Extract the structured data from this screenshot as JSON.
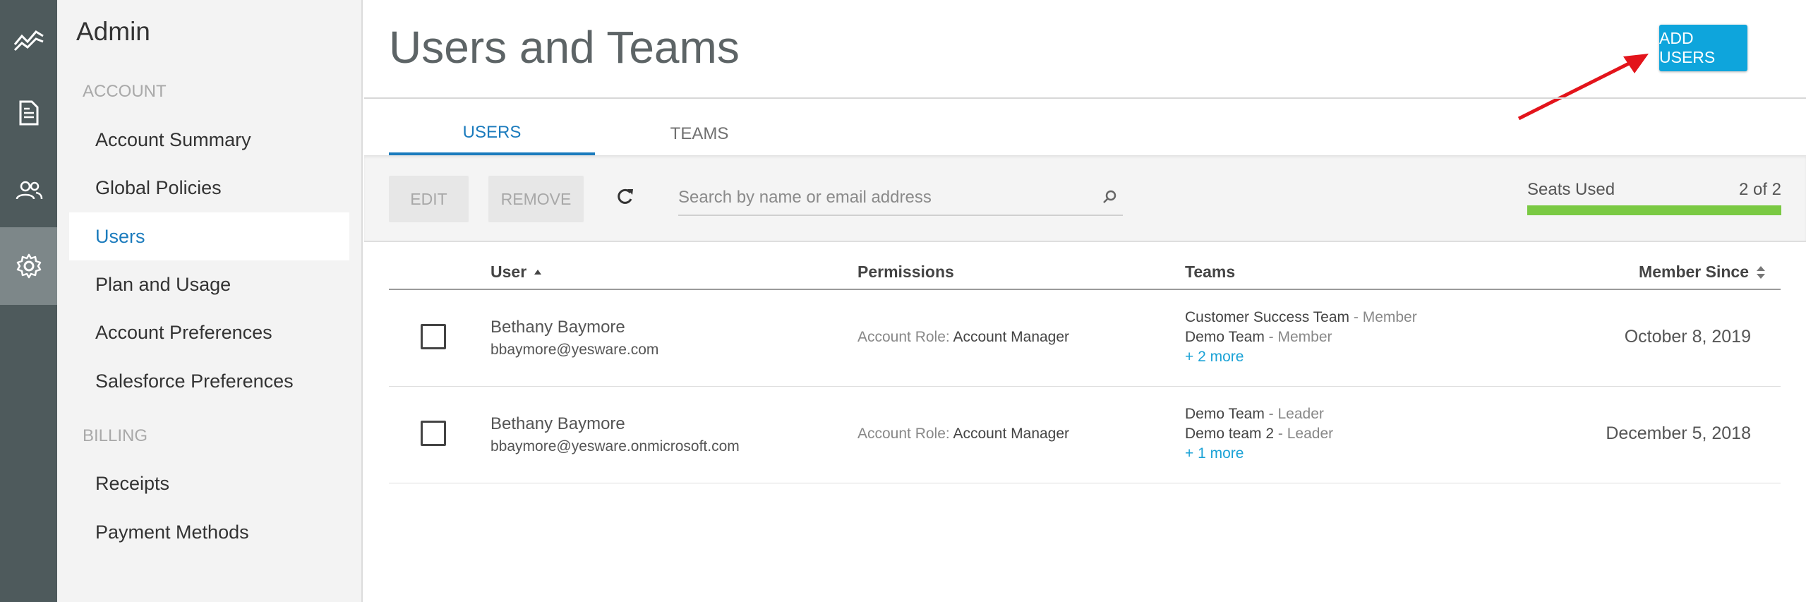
{
  "sidebar": {
    "title": "Admin",
    "section_account": "ACCOUNT",
    "section_billing": "BILLING",
    "account_items": [
      "Account Summary",
      "Global Policies",
      "Users",
      "Plan and Usage",
      "Account Preferences",
      "Salesforce Preferences"
    ],
    "billing_items": [
      "Receipts",
      "Payment Methods"
    ],
    "active_item": "Users"
  },
  "rail": {
    "icons": [
      "analytics-icon",
      "document-icon",
      "people-icon",
      "gear-icon"
    ],
    "active_icon": "gear-icon"
  },
  "header": {
    "title": "Users and Teams",
    "add_users_label": "ADD USERS"
  },
  "tabs": [
    {
      "label": "USERS",
      "active": true
    },
    {
      "label": "TEAMS",
      "active": false
    }
  ],
  "toolbar": {
    "edit_label": "EDIT",
    "remove_label": "REMOVE",
    "search_placeholder": "Search by name or email address",
    "seats_label": "Seats Used",
    "seats_value": "2 of 2",
    "seats_used_fraction": 1.0
  },
  "table": {
    "columns": {
      "user": "User",
      "permissions": "Permissions",
      "teams": "Teams",
      "member_since": "Member Since"
    },
    "rows": [
      {
        "name": "Bethany Baymore",
        "email": "bbaymore@yesware.com",
        "role_label": "Account Role:",
        "role": "Account Manager",
        "teams": [
          {
            "team": "Customer Success Team",
            "role": "- Member"
          },
          {
            "team": "Demo Team",
            "role": "- Member"
          }
        ],
        "more": "+ 2 more",
        "since": "October 8, 2019"
      },
      {
        "name": "Bethany Baymore",
        "email": "bbaymore@yesware.onmicrosoft.com",
        "role_label": "Account Role:",
        "role": "Account Manager",
        "teams": [
          {
            "team": "Demo Team",
            "role": "- Leader"
          },
          {
            "team": "Demo team 2",
            "role": "- Leader"
          }
        ],
        "more": "+ 1 more",
        "since": "December 5, 2018"
      }
    ]
  },
  "colors": {
    "accent": "#0ea5dc",
    "active_link": "#1b7bbd",
    "seats_bar": "#7ac943",
    "annotation_arrow": "#e3141b"
  }
}
